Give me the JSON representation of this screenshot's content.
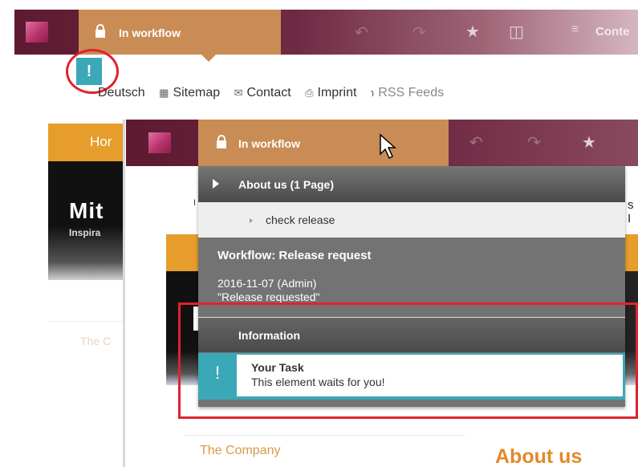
{
  "back_toolbar": {
    "workflow_label": "In workflow",
    "content_label": "Conte"
  },
  "back_page": {
    "task_badge": "!",
    "meta_nav": [
      {
        "label": "Deutsch",
        "icon": "flag-icon"
      },
      {
        "label": "Sitemap",
        "icon": "sitemap-icon"
      },
      {
        "label": "Contact",
        "icon": "mail-icon"
      },
      {
        "label": "Imprint",
        "icon": "imprint-icon"
      },
      {
        "label": "RSS Feeds",
        "icon": "rss-icon"
      }
    ],
    "nav_tab": "Hor",
    "hero_title": "Mit",
    "hero_subtitle": "Inspira",
    "faint_text": "The C"
  },
  "front_toolbar": {
    "workflow_label": "In workflow"
  },
  "front_page": {
    "fragment_right": "s I",
    "fragment_left": "I",
    "company_link": "The Company",
    "heading": "About us"
  },
  "dropdown": {
    "section_header": "About us (1 Page)",
    "action_item": "check release",
    "workflow_title": "Workflow: Release request",
    "workflow_date": "2016-11-07 (Admin)",
    "workflow_status": "\"Release requested\"",
    "info_header": "Information",
    "task_icon": "!",
    "task_title": "Your Task",
    "task_description": "This element waits for you!"
  },
  "colors": {
    "toolbar": "#5e1a31",
    "workflow_tab": "#c98c55",
    "accent_teal": "#3ba8b8",
    "highlight_red": "#e0222e",
    "nav_gold": "#e69d2c"
  }
}
